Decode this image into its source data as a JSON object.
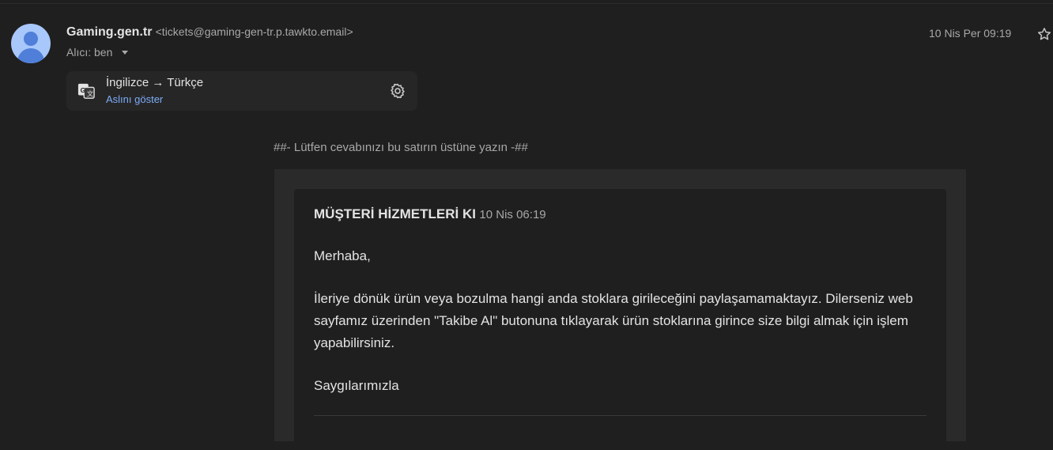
{
  "sender": {
    "name": "Gaming.gen.tr",
    "email": "<tickets@gaming-gen-tr.p.tawkto.email>",
    "recipient": "Alıcı: ben",
    "date": "10 Nis Per 09:19"
  },
  "translation": {
    "languages": "İngilizce → Türkçe",
    "show_original": "Aslını göster"
  },
  "reply_instruction": "##- Lütfen cevabınızı bu satırın üstüne yazın -##",
  "message": {
    "author": "MÜŞTERİ HİZMETLERİ KI",
    "time": "10 Nis 06:19",
    "greeting": "Merhaba,",
    "body": "İleriye dönük ürün veya bozulma hangi anda stoklara girileceğini paylaşamamaktayız. Dilerseniz web sayfamız üzerinden \"Takibe Al\" butonuna tıklayarak ürün stoklarına girince size bilgi almak için işlem yapabilirsiniz.",
    "closing": "Saygılarımızla"
  },
  "icons": {
    "avatar": "avatar-person-icon",
    "caret": "chevron-down-icon",
    "star": "star-icon",
    "translate": "translate-icon",
    "gear": "gear-icon"
  },
  "colors": {
    "background": "#1f1f1f",
    "link": "#7cacf8",
    "avatar": "#a8c7fa"
  }
}
